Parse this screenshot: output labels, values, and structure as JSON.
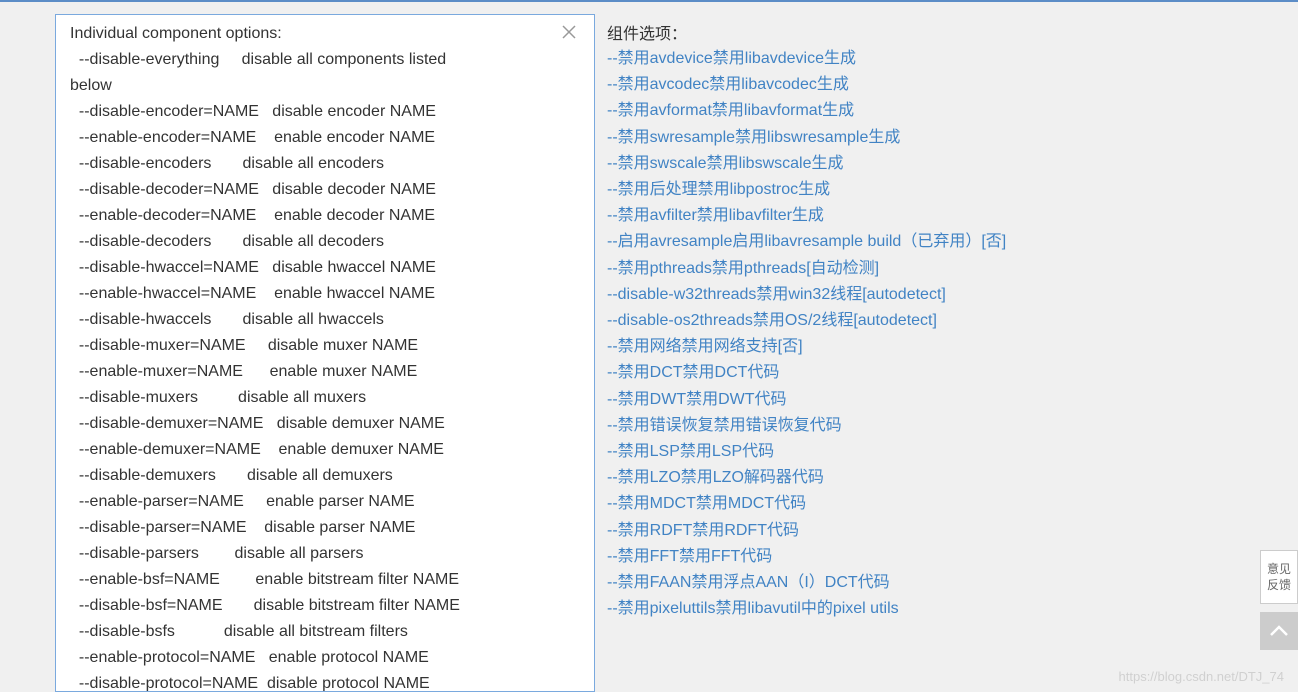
{
  "left": {
    "title": "Individual component options:",
    "lines": [
      "  --disable-everything     disable all components listed below",
      "  --disable-encoder=NAME   disable encoder NAME",
      "  --enable-encoder=NAME    enable encoder NAME",
      "  --disable-encoders       disable all encoders",
      "  --disable-decoder=NAME   disable decoder NAME",
      "  --enable-decoder=NAME    enable decoder NAME",
      "  --disable-decoders       disable all decoders",
      "  --disable-hwaccel=NAME   disable hwaccel NAME",
      "  --enable-hwaccel=NAME    enable hwaccel NAME",
      "  --disable-hwaccels       disable all hwaccels",
      "  --disable-muxer=NAME     disable muxer NAME",
      "  --enable-muxer=NAME      enable muxer NAME",
      "  --disable-muxers         disable all muxers",
      "  --disable-demuxer=NAME   disable demuxer NAME",
      "  --enable-demuxer=NAME    enable demuxer NAME",
      "  --disable-demuxers       disable all demuxers",
      "  --enable-parser=NAME     enable parser NAME",
      "  --disable-parser=NAME    disable parser NAME",
      "  --disable-parsers        disable all parsers",
      "  --enable-bsf=NAME        enable bitstream filter NAME",
      "  --disable-bsf=NAME       disable bitstream filter NAME",
      "  --disable-bsfs           disable all bitstream filters",
      "  --enable-protocol=NAME   enable protocol NAME",
      "  --disable-protocol=NAME  disable protocol NAME"
    ]
  },
  "right": {
    "title": "组件选项：",
    "lines": [
      "--禁用avdevice禁用libavdevice生成",
      "--禁用avcodec禁用libavcodec生成",
      "--禁用avformat禁用libavformat生成",
      "--禁用swresample禁用libswresample生成",
      "--禁用swscale禁用libswscale生成",
      "--禁用后处理禁用libpostroc生成",
      "--禁用avfilter禁用libavfilter生成",
      "--启用avresample启用libavresample build（已弃用）[否]",
      "--禁用pthreads禁用pthreads[自动检测]",
      "--disable-w32threads禁用win32线程[autodetect]",
      "--disable-os2threads禁用OS/2线程[autodetect]",
      "--禁用网络禁用网络支持[否]",
      "--禁用DCT禁用DCT代码",
      "--禁用DWT禁用DWT代码",
      "--禁用错误恢复禁用错误恢复代码",
      "--禁用LSP禁用LSP代码",
      "--禁用LZO禁用LZO解码器代码",
      "--禁用MDCT禁用MDCT代码",
      "--禁用RDFT禁用RDFT代码",
      "--禁用FFT禁用FFT代码",
      "--禁用FAAN禁用浮点AAN（I）DCT代码",
      "--禁用pixeluttils禁用libavutil中的pixel utils"
    ]
  },
  "feedback": {
    "line1": "意见",
    "line2": "反馈"
  },
  "watermark": "https://blog.csdn.net/DTJ_74"
}
